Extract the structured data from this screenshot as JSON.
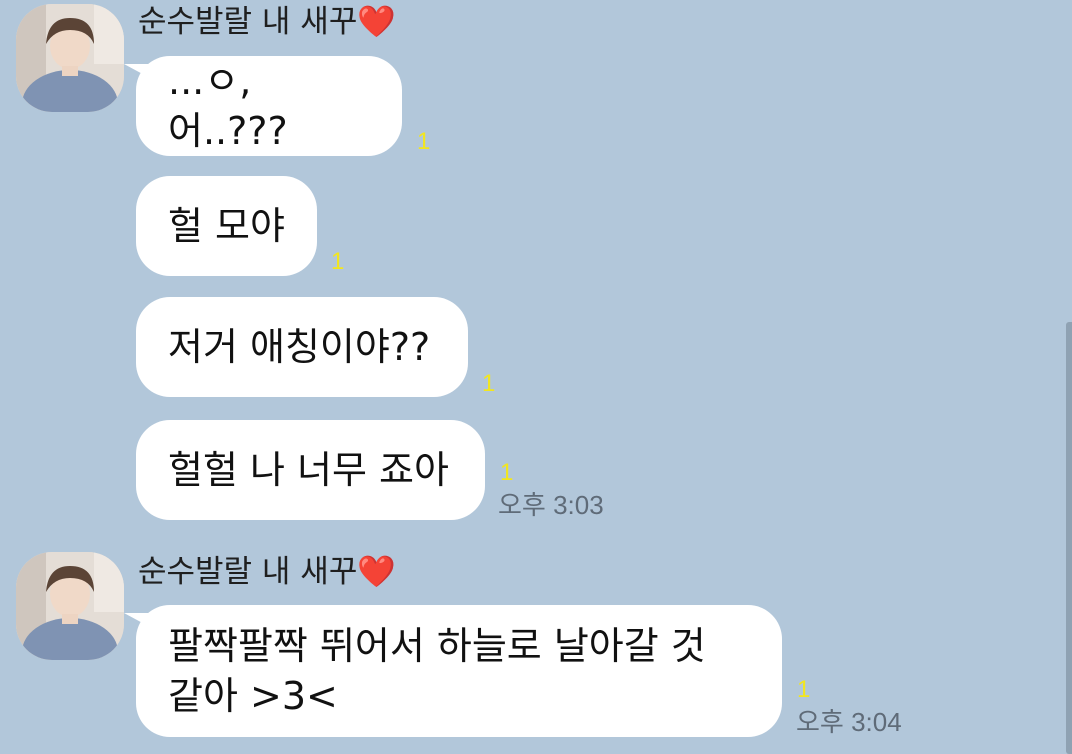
{
  "groups": [
    {
      "sender": {
        "name": "순수발랄 내 새꾸",
        "heart": "❤️"
      },
      "messages": [
        {
          "text": "...ㅇ, 어..???",
          "unread": "1"
        },
        {
          "text": "헐 모야",
          "unread": "1"
        },
        {
          "text": "저거 애칭이야??",
          "unread": "1"
        },
        {
          "text": "헐헐 나 너무 죠아",
          "unread": "1",
          "time": "오후 3:03"
        }
      ]
    },
    {
      "sender": {
        "name": "순수발랄 내 새꾸",
        "heart": "❤️"
      },
      "messages": [
        {
          "text": "팔짝팔짝 뛰어서 하늘로 날아갈 것\n같아 >3<",
          "unread": "1",
          "time": "오후 3:04"
        }
      ]
    }
  ],
  "colors": {
    "background": "#b2c7da",
    "bubble": "#ffffff",
    "unread": "#f2e61f",
    "heart": "#e0202c"
  }
}
